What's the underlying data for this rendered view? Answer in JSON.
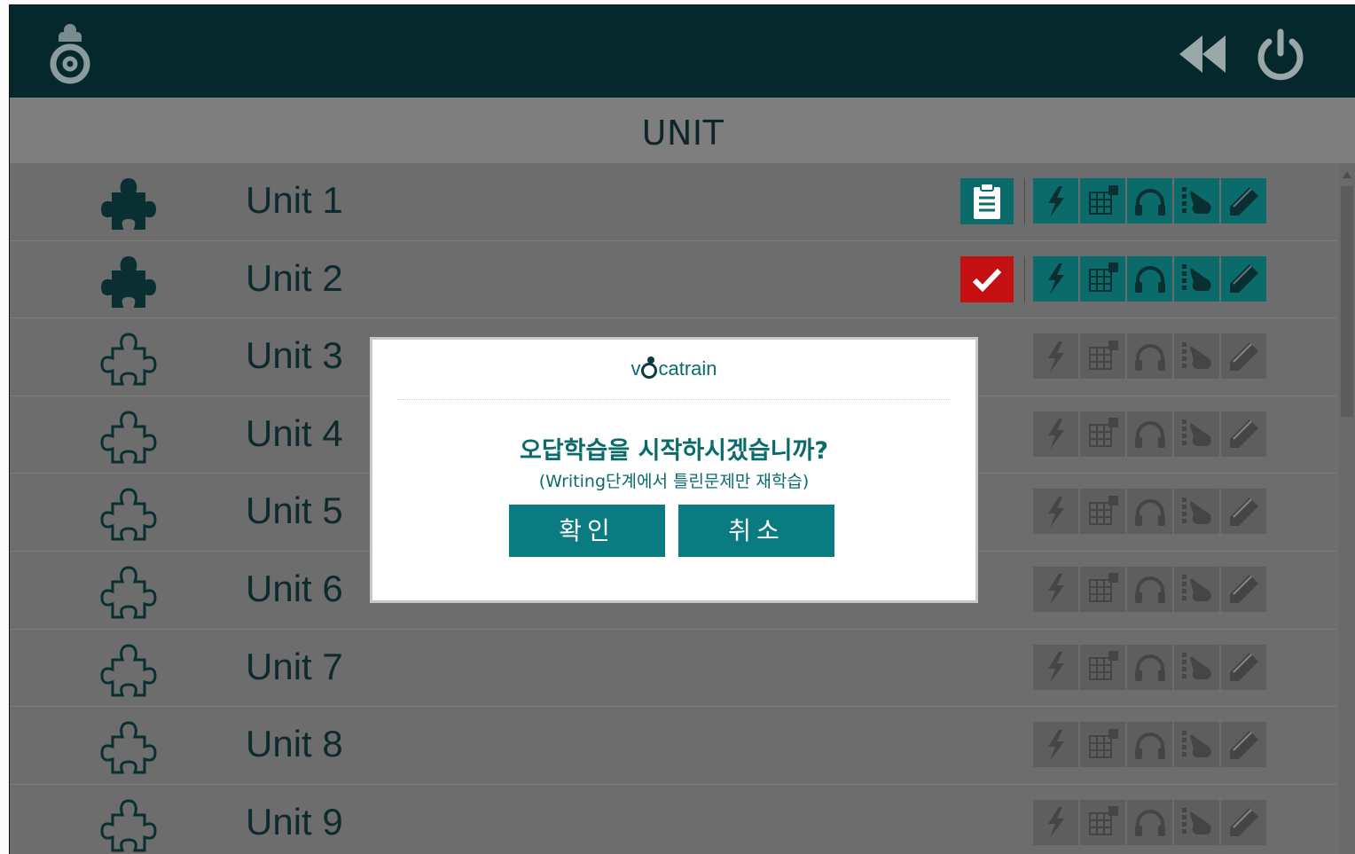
{
  "header": {
    "logo_icon": "vocatrain-logo-icon",
    "back_icon": "rewind-icon",
    "power_icon": "power-icon"
  },
  "title": "UNIT",
  "units": [
    {
      "label": "Unit 1",
      "puzzle": "puzzle-filled-icon",
      "status": "report",
      "active": true
    },
    {
      "label": "Unit 2",
      "puzzle": "puzzle-filled-icon",
      "status": "done",
      "active": true
    },
    {
      "label": "Unit 3",
      "puzzle": "puzzle-outline-icon",
      "status": "",
      "active": false
    },
    {
      "label": "Unit 4",
      "puzzle": "puzzle-outline-icon",
      "status": "",
      "active": false
    },
    {
      "label": "Unit 5",
      "puzzle": "puzzle-outline-icon",
      "status": "",
      "active": false
    },
    {
      "label": "Unit 6",
      "puzzle": "puzzle-outline-icon",
      "status": "",
      "active": false
    },
    {
      "label": "Unit 7",
      "puzzle": "puzzle-outline-icon",
      "status": "",
      "active": false
    },
    {
      "label": "Unit 8",
      "puzzle": "puzzle-outline-icon",
      "status": "",
      "active": false
    },
    {
      "label": "Unit 9",
      "puzzle": "puzzle-outline-icon",
      "status": "",
      "active": false
    }
  ],
  "tool_icons": [
    "lightning-icon",
    "grid-icon",
    "headphones-icon",
    "touch-icon",
    "pencil-icon"
  ],
  "dialog": {
    "brand_pre": "v",
    "brand_post": "catrain",
    "question": "오답학습을 시작하시겠습니까?",
    "note": "(Writing단계에서 틀린문제만 재학습)",
    "confirm_label": "확인",
    "cancel_label": "취소"
  },
  "colors": {
    "header": "#04282c",
    "accent": "#0b6b6b",
    "done": "#c41010",
    "inactive_tool": "#5e5e5e"
  }
}
